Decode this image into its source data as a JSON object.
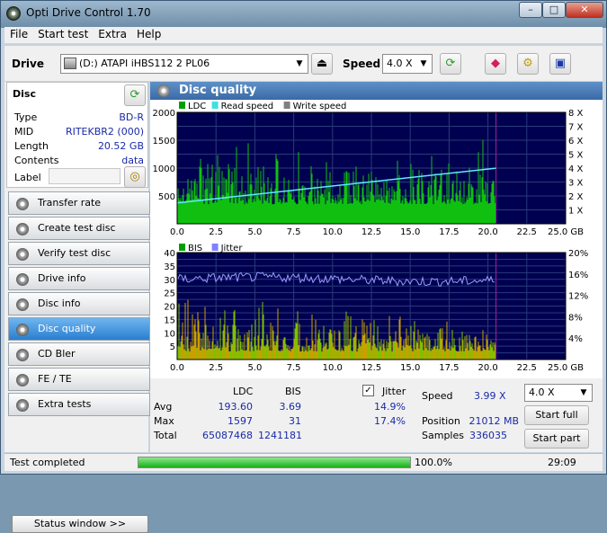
{
  "window": {
    "title": "Opti Drive Control 1.70"
  },
  "menu": [
    "File",
    "Start test",
    "Extra",
    "Help"
  ],
  "toolbar": {
    "drive_label": "Drive",
    "drive_value": "(D:)   ATAPI iHBS112   2 PL06",
    "speed_label": "Speed",
    "speed_value": "4.0 X"
  },
  "disc": {
    "header": "Disc",
    "rows": [
      {
        "k": "Type",
        "v": "BD-R"
      },
      {
        "k": "MID",
        "v": "RITEKBR2 (000)"
      },
      {
        "k": "Length",
        "v": "20.52 GB"
      },
      {
        "k": "Contents",
        "v": "data"
      }
    ],
    "label_key": "Label"
  },
  "nav": [
    "Transfer rate",
    "Create test disc",
    "Verify test disc",
    "Drive info",
    "Disc info",
    "Disc quality",
    "CD Bler",
    "FE / TE",
    "Extra tests"
  ],
  "nav_active": 5,
  "status_window": "Status window >>",
  "panel": {
    "title": "Disc quality"
  },
  "chart_data": [
    {
      "type": "bar",
      "legend": [
        "LDC",
        "Read speed",
        "Write speed"
      ],
      "legend_colors": [
        "#00a000",
        "#40e0e0",
        "#808080"
      ],
      "x_ticks": [
        "0.0",
        "2.5",
        "5.0",
        "7.5",
        "10.0",
        "12.5",
        "15.0",
        "17.5",
        "20.0",
        "22.5",
        "25.0 GB"
      ],
      "y_ticks": [
        "2000",
        "1500",
        "1000",
        "500"
      ],
      "y2_ticks": [
        "8 X",
        "7 X",
        "6 X",
        "5 X",
        "4 X",
        "3 X",
        "2 X",
        "1 X"
      ],
      "xlim": [
        0,
        25
      ],
      "ylim": [
        0,
        2000
      ],
      "data_end": 20.52,
      "read_speed": {
        "x": [
          0,
          20.52
        ],
        "y": [
          1.5,
          3.99
        ]
      },
      "ldc_typical": [
        350,
        800
      ]
    },
    {
      "type": "bar",
      "legend": [
        "BIS",
        "Jitter"
      ],
      "legend_colors": [
        "#00a000",
        "#8080ff"
      ],
      "x_ticks": [
        "0.0",
        "2.5",
        "5.0",
        "7.5",
        "10.0",
        "12.5",
        "15.0",
        "17.5",
        "20.0",
        "22.5",
        "25.0 GB"
      ],
      "y_ticks": [
        "40",
        "35",
        "30",
        "25",
        "20",
        "15",
        "10",
        "5"
      ],
      "y2_ticks": [
        "20%",
        "16%",
        "12%",
        "8%",
        "4%"
      ],
      "xlim": [
        0,
        25
      ],
      "ylim": [
        0,
        40
      ],
      "data_end": 20.52,
      "jitter_level": 15
    }
  ],
  "stats": {
    "col_ldc": "LDC",
    "col_bis": "BIS",
    "jitter_label": "Jitter",
    "rows": [
      {
        "k": "Avg",
        "ldc": "193.60",
        "bis": "3.69",
        "jit": "14.9%"
      },
      {
        "k": "Max",
        "ldc": "1597",
        "bis": "31",
        "jit": "17.4%"
      },
      {
        "k": "Total",
        "ldc": "65087468",
        "bis": "1241181",
        "jit": ""
      }
    ],
    "speed_label": "Speed",
    "speed_value": "3.99 X",
    "position_label": "Position",
    "position_value": "21012 MB",
    "samples_label": "Samples",
    "samples_value": "336035",
    "speed_select": "4.0 X",
    "start_full": "Start full",
    "start_part": "Start part"
  },
  "status": {
    "text": "Test completed",
    "progress": "100.0%",
    "progress_fraction": 1.0,
    "time": "29:09"
  }
}
